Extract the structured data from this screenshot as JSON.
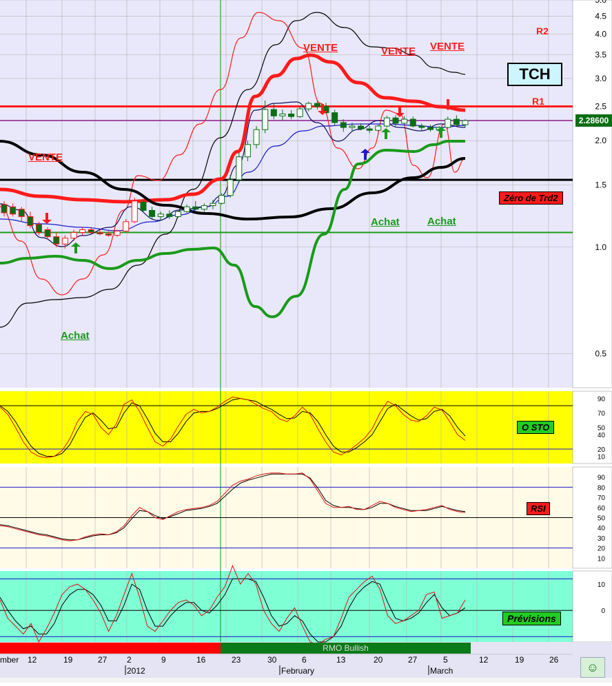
{
  "ticker": "TCH",
  "last_price": "2.28600",
  "colors": {
    "main_bg": "#e8e8fa",
    "sto_bg": "#ffff00",
    "rsi_bg": "#fffbe6",
    "prev_bg": "#7fffd4",
    "up_candle": "#ffffff",
    "down_candle": "#0a6e14",
    "resistance": "#ff1a1a",
    "support": "#1a9a1a"
  },
  "chart_data": [
    {
      "type": "line",
      "name": "price",
      "scale": "log",
      "ylim": [
        0.4,
        5.0
      ],
      "yticks": [
        "5.0",
        "4.5",
        "4.0",
        "3.5",
        "3.0",
        "2.5",
        "2.0",
        "1.5",
        "1.0",
        "0.5"
      ],
      "ytick_values": [
        5.0,
        4.5,
        4.0,
        3.5,
        3.0,
        2.5,
        2.0,
        1.5,
        1.0,
        0.5
      ],
      "levels": [
        {
          "label": "R2",
          "value": 4.2
        },
        {
          "label": "R1",
          "value": 2.5
        },
        {
          "label": "",
          "value": 2.28
        },
        {
          "label": "Zéro de Trd2",
          "value": 1.55
        },
        {
          "label": "",
          "value": 1.1
        }
      ],
      "annotations": [
        {
          "text": "VENTE",
          "color": "#ff1a1a"
        },
        {
          "text": "VENTE",
          "color": "#ff1a1a"
        },
        {
          "text": "VENTE",
          "color": "#ff1a1a"
        },
        {
          "text": "VENTE",
          "color": "#ff1a1a"
        },
        {
          "text": "Achat",
          "color": "#1a9a1a"
        },
        {
          "text": "Achat",
          "color": "#1a9a1a"
        },
        {
          "text": "Achat",
          "color": "#1a9a1a"
        }
      ],
      "candles": [
        {
          "o": 1.32,
          "h": 1.35,
          "l": 1.22,
          "c": 1.25
        },
        {
          "o": 1.3,
          "h": 1.33,
          "l": 1.22,
          "c": 1.24
        },
        {
          "o": 1.28,
          "h": 1.3,
          "l": 1.18,
          "c": 1.22
        },
        {
          "o": 1.22,
          "h": 1.26,
          "l": 1.13,
          "c": 1.15
        },
        {
          "o": 1.16,
          "h": 1.18,
          "l": 1.08,
          "c": 1.1
        },
        {
          "o": 1.12,
          "h": 1.14,
          "l": 1.05,
          "c": 1.07
        },
        {
          "o": 1.07,
          "h": 1.1,
          "l": 1.0,
          "c": 1.02
        },
        {
          "o": 1.02,
          "h": 1.08,
          "l": 0.99,
          "c": 1.06
        },
        {
          "o": 1.06,
          "h": 1.12,
          "l": 1.04,
          "c": 1.1
        },
        {
          "o": 1.1,
          "h": 1.14,
          "l": 1.08,
          "c": 1.12
        },
        {
          "o": 1.12,
          "h": 1.14,
          "l": 1.09,
          "c": 1.1
        },
        {
          "o": 1.1,
          "h": 1.12,
          "l": 1.08,
          "c": 1.09
        },
        {
          "o": 1.09,
          "h": 1.11,
          "l": 1.07,
          "c": 1.08
        },
        {
          "o": 1.08,
          "h": 1.12,
          "l": 1.07,
          "c": 1.11
        },
        {
          "o": 1.11,
          "h": 1.2,
          "l": 1.1,
          "c": 1.18
        },
        {
          "o": 1.18,
          "h": 1.38,
          "l": 1.17,
          "c": 1.35
        },
        {
          "o": 1.34,
          "h": 1.36,
          "l": 1.25,
          "c": 1.27
        },
        {
          "o": 1.27,
          "h": 1.3,
          "l": 1.2,
          "c": 1.22
        },
        {
          "o": 1.22,
          "h": 1.26,
          "l": 1.19,
          "c": 1.24
        },
        {
          "o": 1.24,
          "h": 1.27,
          "l": 1.2,
          "c": 1.22
        },
        {
          "o": 1.22,
          "h": 1.27,
          "l": 1.21,
          "c": 1.26
        },
        {
          "o": 1.26,
          "h": 1.32,
          "l": 1.25,
          "c": 1.3
        },
        {
          "o": 1.3,
          "h": 1.35,
          "l": 1.27,
          "c": 1.28
        },
        {
          "o": 1.28,
          "h": 1.33,
          "l": 1.26,
          "c": 1.31
        },
        {
          "o": 1.31,
          "h": 1.36,
          "l": 1.28,
          "c": 1.33
        },
        {
          "o": 1.33,
          "h": 1.42,
          "l": 1.32,
          "c": 1.4
        },
        {
          "o": 1.4,
          "h": 1.6,
          "l": 1.38,
          "c": 1.55
        },
        {
          "o": 1.55,
          "h": 1.85,
          "l": 1.52,
          "c": 1.8
        },
        {
          "o": 1.8,
          "h": 2.0,
          "l": 1.75,
          "c": 1.95
        },
        {
          "o": 1.95,
          "h": 2.2,
          "l": 1.9,
          "c": 2.15
        },
        {
          "o": 2.15,
          "h": 2.6,
          "l": 2.1,
          "c": 2.45
        },
        {
          "o": 2.45,
          "h": 2.55,
          "l": 2.3,
          "c": 2.35
        },
        {
          "o": 2.35,
          "h": 2.45,
          "l": 2.28,
          "c": 2.38
        },
        {
          "o": 2.38,
          "h": 2.44,
          "l": 2.3,
          "c": 2.34
        },
        {
          "o": 2.34,
          "h": 2.5,
          "l": 2.32,
          "c": 2.46
        },
        {
          "o": 2.46,
          "h": 2.58,
          "l": 2.42,
          "c": 2.55
        },
        {
          "o": 2.55,
          "h": 2.6,
          "l": 2.45,
          "c": 2.5
        },
        {
          "o": 2.5,
          "h": 2.56,
          "l": 2.38,
          "c": 2.4
        },
        {
          "o": 2.4,
          "h": 2.45,
          "l": 2.2,
          "c": 2.25
        },
        {
          "o": 2.25,
          "h": 2.3,
          "l": 2.12,
          "c": 2.18
        },
        {
          "o": 2.18,
          "h": 2.25,
          "l": 2.12,
          "c": 2.2
        },
        {
          "o": 2.2,
          "h": 2.24,
          "l": 2.14,
          "c": 2.16
        },
        {
          "o": 2.16,
          "h": 2.2,
          "l": 2.1,
          "c": 2.14
        },
        {
          "o": 2.14,
          "h": 2.22,
          "l": 2.12,
          "c": 2.2
        },
        {
          "o": 2.2,
          "h": 2.35,
          "l": 2.18,
          "c": 2.32
        },
        {
          "o": 2.32,
          "h": 2.36,
          "l": 2.2,
          "c": 2.24
        },
        {
          "o": 2.24,
          "h": 2.35,
          "l": 2.22,
          "c": 2.3
        },
        {
          "o": 2.3,
          "h": 2.34,
          "l": 2.18,
          "c": 2.2
        },
        {
          "o": 2.2,
          "h": 2.24,
          "l": 2.14,
          "c": 2.18
        },
        {
          "o": 2.18,
          "h": 2.22,
          "l": 2.12,
          "c": 2.15
        },
        {
          "o": 2.15,
          "h": 2.2,
          "l": 2.12,
          "c": 2.18
        },
        {
          "o": 2.18,
          "h": 2.34,
          "l": 2.16,
          "c": 2.3
        },
        {
          "o": 2.3,
          "h": 2.36,
          "l": 2.2,
          "c": 2.22
        },
        {
          "o": 2.22,
          "h": 2.3,
          "l": 2.18,
          "c": 2.28
        }
      ],
      "x_labels": [
        "mber",
        "12",
        "19",
        "27",
        "2",
        "9",
        "16",
        "23",
        "30",
        "6",
        "13",
        "20",
        "27",
        "5",
        "12",
        "19",
        "26"
      ],
      "x_month_labels": [
        "2012",
        "February",
        "March"
      ]
    },
    {
      "type": "line",
      "name": "O STO",
      "ylim": [
        0,
        100
      ],
      "yticks": [
        "90",
        "70",
        "50",
        "40",
        "20",
        "10"
      ],
      "ytick_values": [
        90,
        70,
        50,
        40,
        20,
        10
      ],
      "levels": [
        80,
        20
      ],
      "values": [
        78,
        68,
        50,
        30,
        16,
        10,
        8,
        10,
        18,
        34,
        58,
        72,
        68,
        50,
        40,
        55,
        82,
        88,
        72,
        50,
        30,
        24,
        34,
        52,
        68,
        75,
        70,
        72,
        78,
        86,
        92,
        90,
        88,
        82,
        76,
        72,
        62,
        58,
        66,
        78,
        68,
        48,
        30,
        16,
        12,
        18,
        26,
        35,
        48,
        70,
        86,
        80,
        68,
        60,
        58,
        66,
        78,
        74,
        58,
        40,
        32
      ],
      "signal": [
        80,
        72,
        58,
        40,
        24,
        14,
        10,
        10,
        14,
        26,
        46,
        64,
        70,
        60,
        48,
        50,
        70,
        84,
        80,
        62,
        42,
        30,
        30,
        42,
        58,
        70,
        72,
        72,
        76,
        82,
        88,
        90,
        88,
        86,
        80,
        75,
        68,
        62,
        63,
        72,
        70,
        58,
        40,
        24,
        16,
        16,
        22,
        30,
        40,
        58,
        76,
        82,
        74,
        66,
        60,
        62,
        72,
        75,
        66,
        50,
        38
      ]
    },
    {
      "type": "line",
      "name": "RSI",
      "ylim": [
        0,
        100
      ],
      "yticks": [
        "90",
        "80",
        "70",
        "60",
        "50",
        "40",
        "30",
        "20",
        "10"
      ],
      "ytick_values": [
        90,
        80,
        70,
        60,
        50,
        40,
        30,
        20,
        10
      ],
      "levels": [
        80,
        50,
        20
      ],
      "values": [
        42,
        41,
        39,
        37,
        35,
        33,
        32,
        30,
        28,
        27,
        28,
        31,
        33,
        34,
        33,
        36,
        42,
        52,
        60,
        56,
        50,
        48,
        52,
        56,
        58,
        59,
        60,
        62,
        66,
        74,
        82,
        86,
        88,
        91,
        93,
        94,
        94,
        93,
        93,
        94,
        88,
        76,
        64,
        60,
        60,
        61,
        58,
        58,
        62,
        66,
        64,
        60,
        58,
        56,
        57,
        58,
        60,
        62,
        58,
        56,
        55
      ],
      "signal": [
        43,
        42,
        40,
        38,
        36,
        34,
        33,
        31,
        29,
        28,
        28,
        30,
        32,
        33,
        33,
        35,
        40,
        49,
        57,
        56,
        52,
        49,
        51,
        54,
        57,
        58,
        59,
        61,
        64,
        71,
        78,
        84,
        87,
        89,
        91,
        93,
        93,
        93,
        93,
        93,
        89,
        79,
        67,
        62,
        60,
        60,
        59,
        58,
        60,
        64,
        64,
        61,
        59,
        57,
        57,
        57,
        59,
        61,
        59,
        57,
        56
      ]
    },
    {
      "type": "line",
      "name": "Prévisions",
      "ylim": [
        -12,
        15
      ],
      "yticks": [
        "10",
        "0"
      ],
      "ytick_values": [
        10,
        0
      ],
      "levels": [
        12,
        0,
        -10
      ],
      "values": [
        4,
        -3,
        -6,
        -9,
        -5,
        -12,
        -7,
        -1,
        6,
        9,
        10,
        8,
        4,
        -1,
        -8,
        -2,
        6,
        14,
        5,
        -6,
        -8,
        -4,
        0,
        3,
        4,
        2,
        -2,
        0,
        5,
        9,
        17,
        10,
        14,
        10,
        0,
        -5,
        -8,
        -3,
        1,
        -6,
        -12,
        -13,
        -11,
        -10,
        -3,
        5,
        8,
        11,
        13,
        8,
        -2,
        -5,
        -4,
        -2,
        0,
        6,
        7,
        -3,
        -2,
        -1,
        4
      ],
      "signal": [
        5,
        0,
        -4,
        -7,
        -6,
        -9,
        -9,
        -5,
        2,
        6,
        8,
        8,
        6,
        2,
        -4,
        -4,
        2,
        10,
        8,
        0,
        -6,
        -6,
        -2,
        1,
        3,
        3,
        0,
        -1,
        2,
        6,
        12,
        12,
        12,
        11,
        5,
        -2,
        -6,
        -5,
        -2,
        -4,
        -9,
        -12,
        -12,
        -10,
        -6,
        1,
        6,
        9,
        11,
        10,
        3,
        -3,
        -4,
        -3,
        -1,
        3,
        6,
        1,
        -2,
        -1,
        1
      ]
    }
  ],
  "indicator_labels": {
    "sto": "O STO",
    "rsi": "RSI",
    "prev": "Prévisions",
    "zero_trd2": "Zéro de Trd2"
  },
  "rmo_bar": {
    "bearish_label": "",
    "bullish_label": "RMO Bullish"
  }
}
